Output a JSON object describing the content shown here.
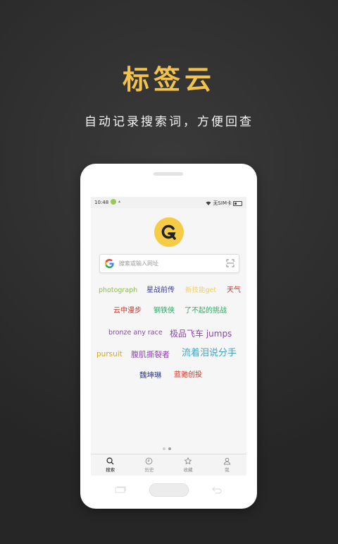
{
  "promo": {
    "title": "标签云",
    "subtitle": "自动记录搜索词，方便回查"
  },
  "status_bar": {
    "time": "10:48",
    "carrier": "无SIM卡"
  },
  "search": {
    "placeholder": "搜索或输入网址"
  },
  "tags": [
    {
      "text": "photograph",
      "color": "#8cbf4a"
    },
    {
      "text": "星战前传",
      "color": "#3e3e8a"
    },
    {
      "text": "新技能get",
      "color": "#f0cf6a"
    },
    {
      "text": "天气",
      "color": "#c0392b"
    },
    {
      "text": "云中漫步",
      "color": "#c0392b"
    },
    {
      "text": "钢铁侠",
      "color": "#27ae60"
    },
    {
      "text": "了不起的挑战",
      "color": "#27ae60"
    },
    {
      "text": "bronze any race",
      "color": "#8e44ad"
    },
    {
      "text": "极品飞车 jumps",
      "color": "#8e44ad"
    },
    {
      "text": "pursuit",
      "color": "#d4a72c"
    },
    {
      "text": "腹肌撕裂者",
      "color": "#8e44ad"
    },
    {
      "text": "流着泪说分手",
      "color": "#3aa7c8"
    },
    {
      "text": "魏坤琳",
      "color": "#2c3e8f"
    },
    {
      "text": "蓝驰创投",
      "color": "#c0392b"
    }
  ],
  "tabs": [
    {
      "label": "搜索",
      "icon": "search-icon",
      "active": true
    },
    {
      "label": "历史",
      "icon": "clock-icon",
      "active": false
    },
    {
      "label": "收藏",
      "icon": "star-icon",
      "active": false
    },
    {
      "label": "我",
      "icon": "person-icon",
      "active": false
    }
  ],
  "colors": {
    "accent": "#f6cc47",
    "title": "#f2c24a"
  }
}
